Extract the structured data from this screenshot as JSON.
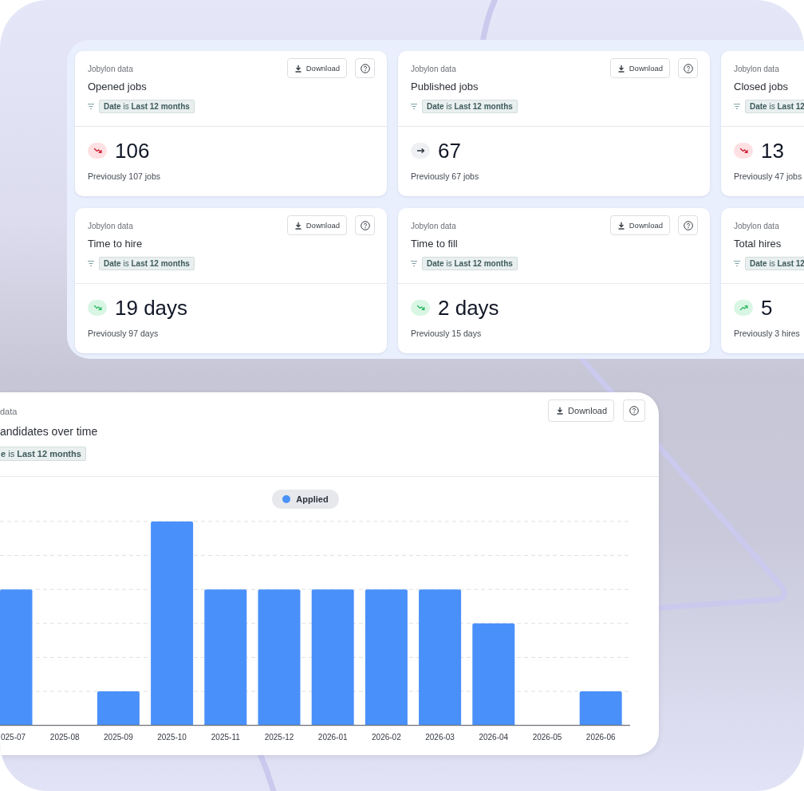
{
  "metric_cards": [
    {
      "source": "Jobylon data",
      "title": "Opened jobs",
      "filter": "**Date** is **Last 12 months**",
      "download_label": "Download",
      "trend": {
        "kind": "down",
        "color": "#ffe0e3"
      },
      "value": "106",
      "previous": "Previously 107 jobs"
    },
    {
      "source": "Jobylon data",
      "title": "Published jobs",
      "filter": "**Date** is **Last 12 months**",
      "download_label": "Download",
      "trend": {
        "kind": "flat",
        "color": "#eef0f3"
      },
      "value": "67",
      "previous": "Previously 67 jobs"
    },
    {
      "source": "Jobylon data",
      "title": "Closed jobs",
      "filter": "**Date** is **Last 12**",
      "trend": {
        "kind": "down",
        "color": "#ffe0e3"
      },
      "value": "13",
      "previous": "Previously 47 jobs"
    },
    {
      "source": "Jobylon data",
      "title": "Time to hire",
      "filter": "**Date** is **Last 12 months**",
      "download_label": "Download",
      "trend": {
        "kind": "down",
        "color": "#d9f6e4"
      },
      "value": "19 days",
      "previous": "Previously 97 days"
    },
    {
      "source": "Jobylon data",
      "title": "Time to fill",
      "filter": "**Date** is **Last 12 months**",
      "download_label": "Download",
      "trend": {
        "kind": "down",
        "color": "#d9f6e4"
      },
      "value": "2 days",
      "previous": "Previously 15 days"
    },
    {
      "source": "Jobylon data",
      "title": "Total hires",
      "filter": "**Date** is **Last 12**",
      "trend": {
        "kind": "up",
        "color": "#d9f6e4"
      },
      "value": "5",
      "previous": "Previously 3 hires"
    }
  ],
  "chart_card": {
    "source": "data",
    "title": "andidates over time",
    "filter": "**e** is **Last 12 months**",
    "download_label": "Download",
    "legend": [
      {
        "label": "Applied",
        "color": "#4a90fa"
      }
    ],
    "x_labels": [
      "025-07",
      "2025-08",
      "2025-09",
      "2025-10",
      "2025-11",
      "2025-12",
      "2026-01",
      "2026-02",
      "2026-03",
      "2026-04",
      "2026-05",
      "2026-06"
    ]
  }
}
